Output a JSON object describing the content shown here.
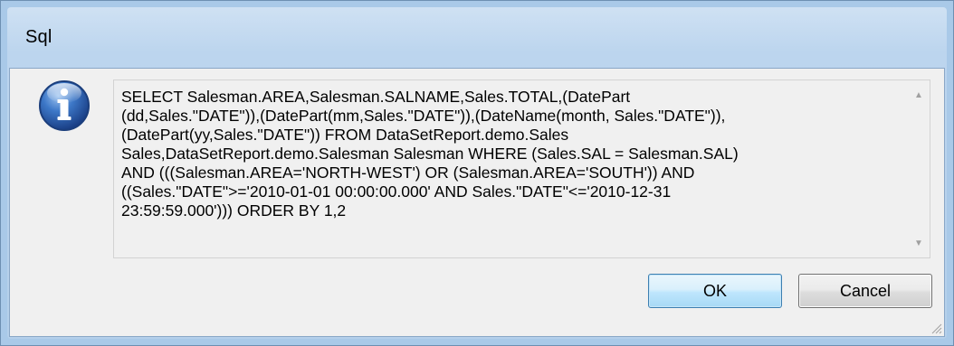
{
  "dialog": {
    "title": "Sql",
    "icon": "info-icon",
    "message": "SELECT Salesman.AREA,Salesman.SALNAME,Sales.TOTAL,(DatePart\n(dd,Sales.\"DATE\")),(DatePart(mm,Sales.\"DATE\")),(DateName(month, Sales.\"DATE\")),\n(DatePart(yy,Sales.\"DATE\")) FROM DataSetReport.demo.Sales\nSales,DataSetReport.demo.Salesman Salesman WHERE (Sales.SAL = Salesman.SAL)\nAND (((Salesman.AREA='NORTH-WEST') OR (Salesman.AREA='SOUTH')) AND\n((Sales.\"DATE\">='2010-01-01 00:00:00.000' AND Sales.\"DATE\"<='2010-12-31\n23:59:59.000'))) ORDER BY 1,2",
    "ok_label": "OK",
    "cancel_label": "Cancel"
  },
  "colors": {
    "frame": "#b4cfea",
    "client": "#f0f0f0",
    "ok_border": "#3c7fb1"
  }
}
